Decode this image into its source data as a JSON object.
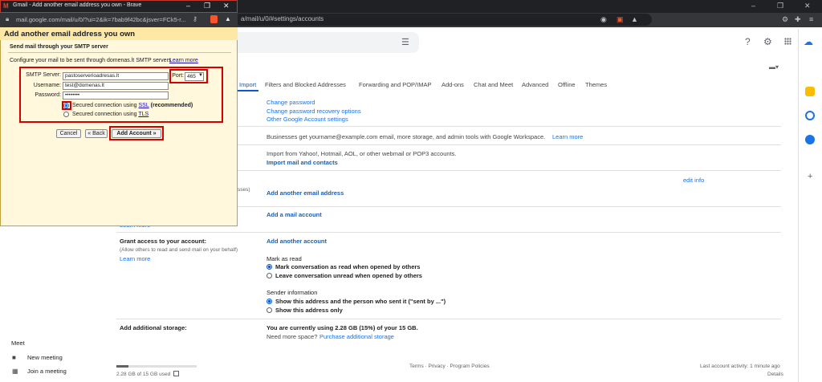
{
  "browser": {
    "url": "a/mail/u/0/#settings/accounts",
    "window_controls": [
      "–",
      "❐",
      "✕"
    ]
  },
  "popup": {
    "window_title": "Gmail - Add another email address you own - Brave",
    "url": "mail.google.com/mail/u/0/?ui=2&ik=7bab9f42bc&jsver=FCk5-r...",
    "heading": "Add another email address you own",
    "subheading": "Send mail through your SMTP server",
    "description": "Configure your mail to be sent through domenas.lt SMTP servers",
    "learn_more": "Learn more",
    "smtp_label": "SMTP Server:",
    "smtp_value": "pastoserverioadresas.lt",
    "port_label": "Port:",
    "port_value": "465",
    "username_label": "Username:",
    "username_value": "test@domenas.lt",
    "password_label": "Password:",
    "password_value": "••••••••",
    "ssl_prefix": "Secured connection using ",
    "ssl_link": "SSL",
    "ssl_suffix": " (recommended)",
    "tls_prefix": "Secured connection using ",
    "tls_link": "TLS",
    "cancel": "Cancel",
    "back": "« Back",
    "add_account": "Add Account »"
  },
  "tabs": [
    {
      "label": "Import"
    },
    {
      "label": "Filters and Blocked Addresses"
    },
    {
      "label": "Forwarding and POP/IMAP"
    },
    {
      "label": "Add-ons"
    },
    {
      "label": "Chat and Meet"
    },
    {
      "label": "Advanced"
    },
    {
      "label": "Offline"
    },
    {
      "label": "Themes"
    }
  ],
  "settings": {
    "change_password": "Change password",
    "change_recovery": "Change password recovery options",
    "other_google": "Other Google Account settings",
    "workspace_text": "Businesses get yourname@example.com email, more storage, and admin tools with Google Workspace.",
    "workspace_link": "Learn more",
    "import_text": "Import from Yahoo!, Hotmail, AOL, or other webmail or POP3 accounts.",
    "import_link": "Import mail and contacts",
    "edit_info": "edit info",
    "partial_label": "sses)",
    "add_email": "Add another email address",
    "add_mail_account": "Add a mail account",
    "learn_more_partial": "Learn more",
    "grant_label": "Grant access to your account:",
    "grant_sub": "(Allow others to read and send mail on your behalf)",
    "grant_learn": "Learn more",
    "add_another_account": "Add another account",
    "mark_as_read": "Mark as read",
    "mark_opt1": "Mark conversation as read when opened by others",
    "mark_opt2": "Leave conversation unread when opened by others",
    "sender_info": "Sender information",
    "sender_opt1": "Show this address and the person who sent it (\"sent by ...\")",
    "sender_opt2": "Show this address only",
    "storage_label": "Add additional storage:",
    "storage_using": "You are currently using 2.28 GB (15%) of your 15 GB.",
    "need_more": "Need more space?",
    "purchase": "Purchase additional storage"
  },
  "footer": {
    "storage_used": "2.28 GB of 15 GB used",
    "storage_fraction": 0.15,
    "links": "Terms · Privacy · Program Policies",
    "last_activity": "Last account activity: 1 minute ago",
    "details": "Details"
  },
  "meet": {
    "title": "Meet",
    "new_meeting": "New meeting",
    "join_meeting": "Join a meeting"
  }
}
